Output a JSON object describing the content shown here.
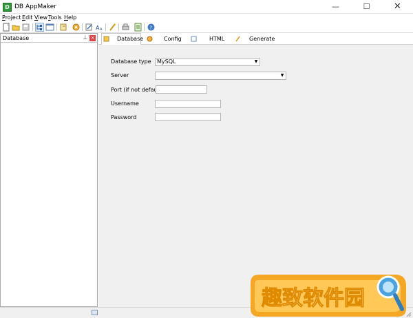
{
  "window": {
    "app_icon_letter": "D",
    "title": "DB AppMaker",
    "minimize_glyph": "—",
    "maximize_glyph": "☐",
    "close_glyph": "✕"
  },
  "menu": {
    "items": [
      "Project",
      "Edit",
      "View",
      "Tools",
      "Help"
    ]
  },
  "toolbar": {
    "buttons": [
      "new-icon",
      "open-icon",
      "save-icon",
      "tree-icon",
      "window-icon",
      "import-icon",
      "package-icon",
      "edit-icon",
      "font-icon",
      "wand-icon",
      "print-icon",
      "document-icon",
      "help-icon"
    ]
  },
  "left_panel": {
    "title": "Database",
    "pin_glyph": "⊥",
    "close_glyph": "×"
  },
  "tabs": [
    {
      "label": "Database",
      "icon": "database-icon",
      "active": true
    },
    {
      "label": "Config",
      "icon": "config-icon",
      "active": false
    },
    {
      "label": "HTML",
      "icon": "html-icon",
      "active": false
    },
    {
      "label": "Generate",
      "icon": "generate-icon",
      "active": false
    }
  ],
  "form": {
    "database_type": {
      "label": "Database type",
      "value": "MySQL",
      "arrow": "▼"
    },
    "server": {
      "label": "Server",
      "value": "",
      "arrow": "▼"
    },
    "port": {
      "label": "Port (if not default)",
      "value": ""
    },
    "username": {
      "label": "Username",
      "value": ""
    },
    "password": {
      "label": "Password",
      "value": ""
    }
  },
  "watermark": {
    "text": "趣致软件园",
    "colors": {
      "frame": "#f5a623",
      "text": "#ffffff",
      "magnifier": "#4aa3e0"
    }
  }
}
